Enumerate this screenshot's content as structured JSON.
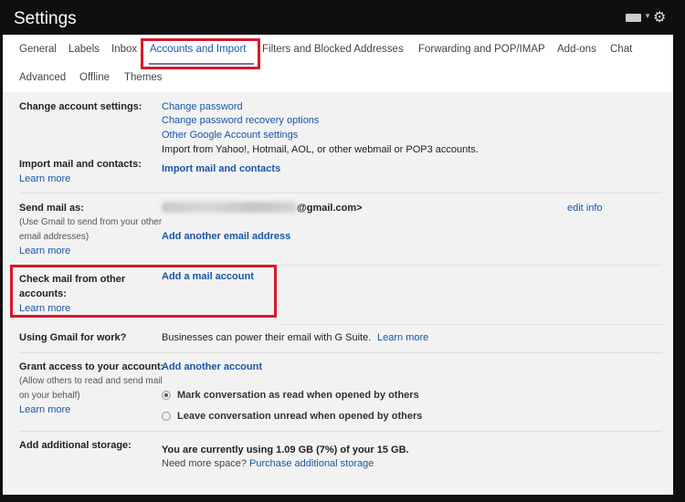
{
  "header": {
    "title": "Settings",
    "icons": [
      "keyboard-icon",
      "chevron-down-icon",
      "gear-icon"
    ]
  },
  "tabs": [
    "General",
    "Labels",
    "Inbox",
    "Accounts and Import",
    "Filters and Blocked Addresses",
    "Forwarding and POP/IMAP",
    "Add-ons",
    "Chat",
    "Advanced",
    "Offline",
    "Themes"
  ],
  "active_tab": "Accounts and Import",
  "colors": {
    "link": "#1a55a8",
    "highlight": "#d7192b",
    "header_bg": "#0f0f0f"
  },
  "sections": {
    "change": {
      "label": "Change account settings:",
      "links": [
        "Change password",
        "Change password recovery options",
        "Other Google Account settings"
      ]
    },
    "import": {
      "label": "Import mail and contacts:",
      "note": "Import from Yahoo!, Hotmail, AOL, or other webmail or POP3 accounts.",
      "learn": "Learn more",
      "action": "Import mail and contacts"
    },
    "send": {
      "label": "Send mail as:",
      "sub1": "(Use Gmail to send from your other",
      "sub2": "email addresses)",
      "learn": "Learn more",
      "email_suffix": "@gmail.com>",
      "edit": "edit info",
      "action": "Add another email address"
    },
    "check": {
      "label1": "Check mail from other",
      "label2": "accounts:",
      "learn": "Learn more",
      "action": "Add a mail account"
    },
    "work": {
      "label": "Using Gmail for work?",
      "text": "Businesses can power their email with G Suite.",
      "learn": "Learn more"
    },
    "grant": {
      "label": "Grant access to your account:",
      "sub1": "(Allow others to read and send mail",
      "sub2": "on your behalf)",
      "learn": "Learn more",
      "action": "Add another account",
      "opt1": "Mark conversation as read when opened by others",
      "opt2": "Leave conversation unread when opened by others",
      "selected": "opt1"
    },
    "storage": {
      "label": "Add additional storage:",
      "usage": "You are currently using 1.09 GB (7%) of your 15 GB.",
      "need": "Need more space?",
      "action": "Purchase additional storage"
    }
  }
}
